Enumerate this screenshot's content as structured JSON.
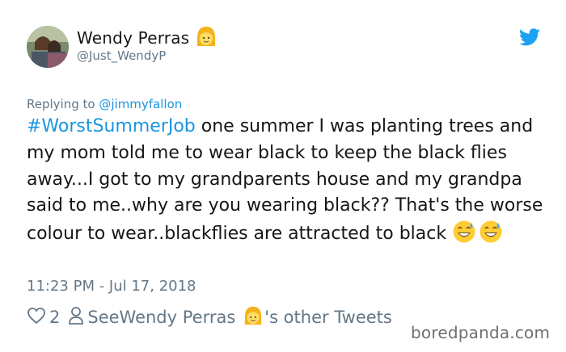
{
  "author": {
    "display_name": "Wendy Perras",
    "handle": "@Just_WendyP",
    "name_emoji": "woman-blond-hair-emoji"
  },
  "reply": {
    "prefix": "Replying to",
    "mention": "@jimmyfallon"
  },
  "tweet": {
    "hashtag": "#WorstSummerJob",
    "body": " one summer I was planting trees and my mom told me to wear black to keep the black flies away...I got to my grandparents house and my grandpa said to me..why are you wearing black?? That's the worse colour to wear..blackflies are attracted to black ",
    "end_emojis": [
      "grinning-sweat-emoji",
      "grinning-sweat-emoji"
    ]
  },
  "timestamp": "11:23 PM - Jul 17, 2018",
  "actions": {
    "like_count": "2",
    "see_prefix": "See ",
    "see_name": "Wendy Perras",
    "see_suffix": "'s other Tweets"
  },
  "watermark": "boredpanda.com",
  "colors": {
    "link": "#1b95e0",
    "muted": "#657786",
    "text": "#14171a",
    "twitter_blue": "#1da1f2"
  },
  "icons": [
    "twitter-bird-icon",
    "heart-icon",
    "person-icon"
  ]
}
